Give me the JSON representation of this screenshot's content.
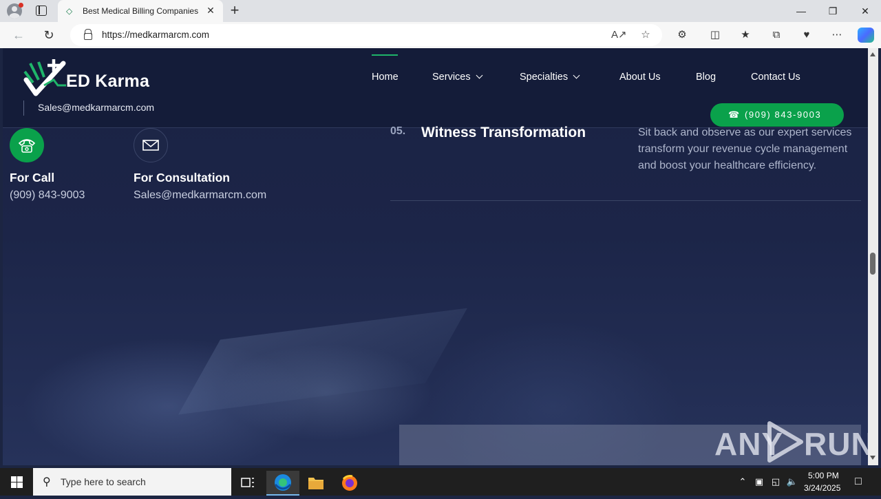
{
  "browser": {
    "tab_title": "Best Medical Billing Companies i",
    "url": "https://medkarmarcm.com",
    "icons": [
      "profile-icon",
      "tab-actions-icon",
      "close-icon",
      "new-tab-icon",
      "back-icon",
      "refresh-icon",
      "lock-icon",
      "read-aloud-icon",
      "favorite-star-icon",
      "extensions-icon",
      "split-screen-icon",
      "favorites-icon",
      "collections-icon",
      "browser-essentials-icon",
      "more-icon",
      "copilot-icon"
    ]
  },
  "site": {
    "logo_text": "ED Karma",
    "header_email": "Sales@medkarmarcm.com",
    "nav": {
      "home": "Home",
      "services": "Services",
      "specialties": "Specialties",
      "about": "About Us",
      "blog": "Blog",
      "contact": "Contact Us"
    },
    "phone_button": "(909) 843-9003",
    "contacts": {
      "call_title": "For Call",
      "call_value": "(909) 843-9003",
      "consult_title": "For Consultation",
      "consult_value": "Sales@medkarmarcm.com"
    },
    "step": {
      "number": "05.",
      "title": "Witness Transformation",
      "description": "Sit back and observe as our expert services transform your revenue cycle management and boost your healthcare efficiency."
    },
    "watermark_left": "ANY",
    "watermark_right": "RUN",
    "colors": {
      "accent_green": "#0aa14b",
      "nav_bg": "#141c39",
      "page_bg": "#1b2341"
    }
  },
  "taskbar": {
    "search_placeholder": "Type here to search",
    "time": "5:00 PM",
    "date": "3/24/2025"
  }
}
